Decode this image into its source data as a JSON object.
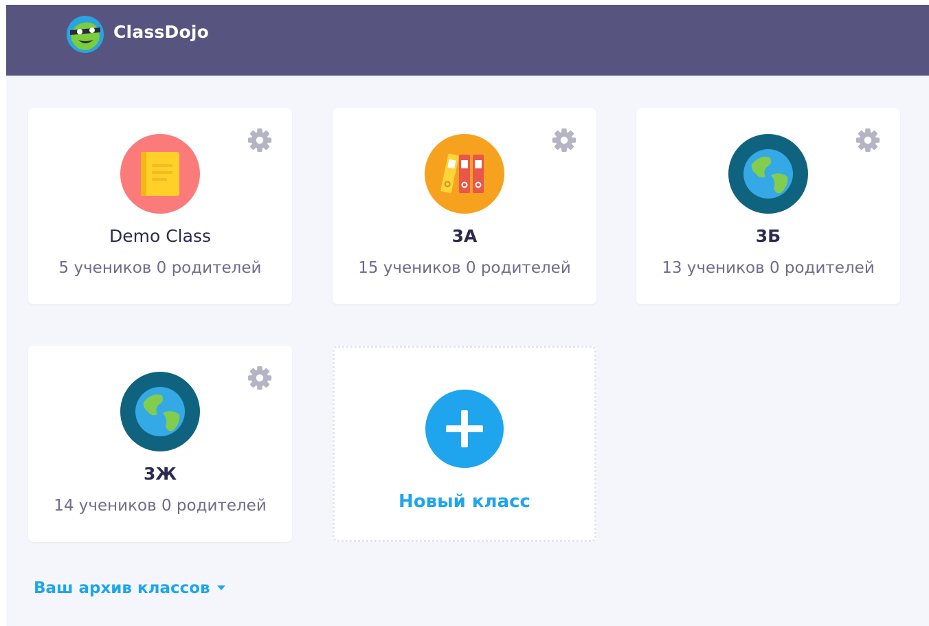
{
  "header": {
    "brand": "ClassDojo",
    "logo_icon": "classdojo-monster-icon",
    "background_color": "#575580"
  },
  "classes": [
    {
      "title": "Demo Class",
      "subtitle": "5 учеников 0 родителей",
      "avatar_icon": "notebook-icon",
      "avatar_color": "#fb7b7b"
    },
    {
      "title": "3А",
      "subtitle": "15 учеников 0 родителей",
      "avatar_icon": "binders-icon",
      "avatar_color": "#f6a21e"
    },
    {
      "title": "3Б",
      "subtitle": "13 учеников 0 родителей",
      "avatar_icon": "globe-icon",
      "avatar_color": "#10637e"
    },
    {
      "title": "3Ж",
      "subtitle": "14 учеников 0 родителей",
      "avatar_icon": "globe-icon",
      "avatar_color": "#10637e"
    }
  ],
  "new_class": {
    "label": "Новый класс",
    "icon": "plus-icon",
    "color": "#1ea5ed"
  },
  "archive": {
    "label": "Ваш архив классов",
    "icon": "caret-down-icon"
  },
  "colors": {
    "accent": "#1ea5ed",
    "page_background": "#f4f6fc",
    "gear": "#b4b4c4"
  }
}
